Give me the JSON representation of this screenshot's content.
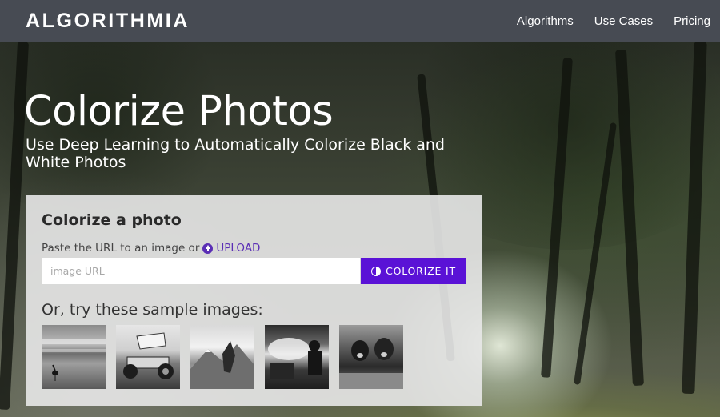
{
  "nav": {
    "logo": "ALGORITHMIA",
    "links": [
      "Algorithms",
      "Use Cases",
      "Pricing"
    ]
  },
  "hero": {
    "title": "Colorize Photos",
    "subtitle": "Use Deep Learning to Automatically Colorize Black and White Photos"
  },
  "card": {
    "title": "Colorize a photo",
    "paste_text": "Paste the URL to an image or",
    "upload_label": "UPLOAD",
    "input_placeholder": "image URL",
    "input_value": "",
    "button_label": "COLORIZE IT",
    "samples_label": "Or, try these sample images:",
    "samples": [
      {
        "icon": "bird-on-beach-photo"
      },
      {
        "icon": "sprint-car-photo"
      },
      {
        "icon": "mountain-climber-photo"
      },
      {
        "icon": "people-in-mist-photo"
      },
      {
        "icon": "cows-in-field-photo"
      }
    ]
  },
  "colors": {
    "navbar": "#474b53",
    "accent": "#5a12d6",
    "upload_link": "#5b2fb5",
    "card_bg": "#e8e8e8"
  }
}
